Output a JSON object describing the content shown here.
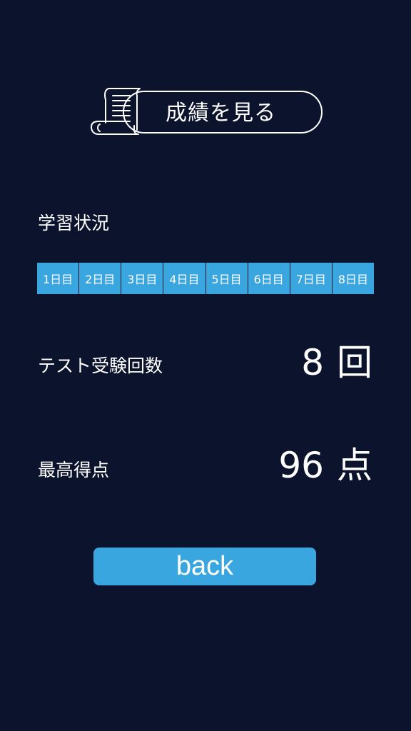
{
  "header": {
    "title": "成績を見る",
    "icon": "scroll-icon"
  },
  "study_status": {
    "label": "学習状況",
    "days": [
      "1日目",
      "2日目",
      "3日目",
      "4日目",
      "5日目",
      "6日目",
      "7日目",
      "8日目"
    ]
  },
  "test_count": {
    "label": "テスト受験回数",
    "value": "8",
    "unit": "回"
  },
  "high_score": {
    "label": "最高得点",
    "value": "96",
    "unit": "点"
  },
  "back_button": {
    "label": "back"
  },
  "colors": {
    "background": "#0c132c",
    "accent": "#3aa6e0",
    "text": "#ffffff"
  }
}
